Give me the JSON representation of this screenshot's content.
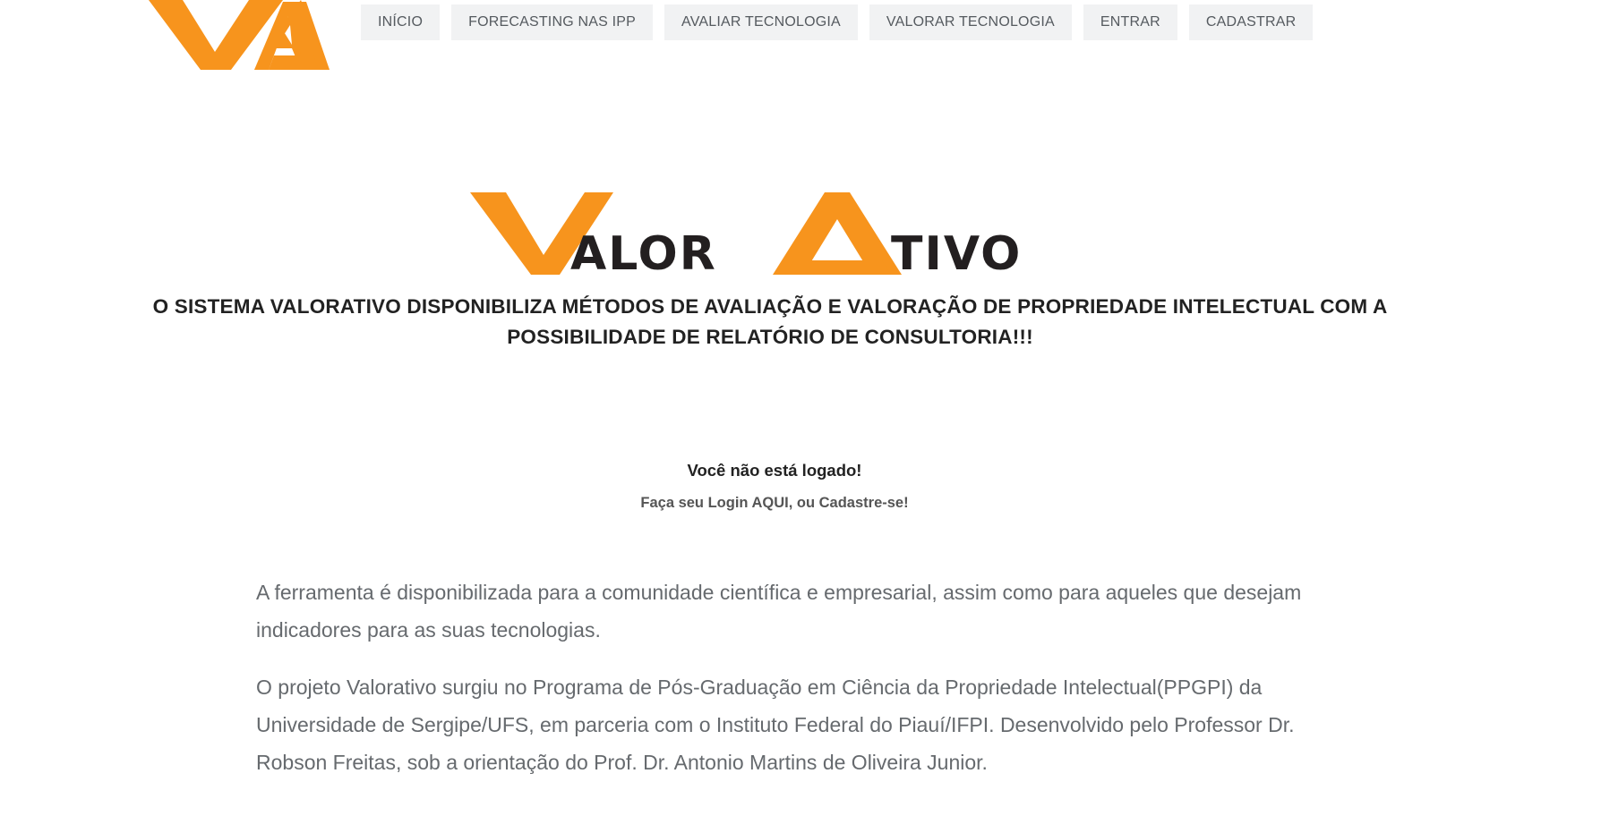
{
  "brand": {
    "logo_alt": "VA",
    "accent_color": "#f7941d",
    "dark_color": "#231f20"
  },
  "nav": {
    "items": [
      {
        "label": "INÍCIO"
      },
      {
        "label": "FORECASTING NAS IPP"
      },
      {
        "label": "AVALIAR TECNOLOGIA"
      },
      {
        "label": "VALORAR TECNOLOGIA"
      },
      {
        "label": "ENTRAR"
      },
      {
        "label": "CADASTRAR"
      }
    ]
  },
  "hero": {
    "logo_letter_v": "V",
    "logo_text_1": "ALOR",
    "logo_letter_a": "A",
    "logo_text_2": "TIVO",
    "tagline_line1": "O SISTEMA VALORATIVO DISPONIBILIZA MÉTODOS DE AVALIAÇÃO E VALORAÇÃO DE PROPRIEDADE INTELECTUAL COM A",
    "tagline_line2": "POSSIBILIDADE DE RELATÓRIO DE CONSULTORIA!!!"
  },
  "login_notice": {
    "title": "Você não está logado!",
    "subtitle": "Faça seu Login AQUI, ou Cadastre-se!"
  },
  "content": {
    "paragraph1": "A ferramenta é disponibilizada para a comunidade científica e empresarial, assim como para aqueles que desejam indicadores para as suas tecnologias.",
    "paragraph2": "O projeto Valorativo surgiu no Programa de Pós-Graduação em Ciência da Propriedade Intelectual(PPGPI) da Universidade de Sergipe/UFS, em parceria com o Instituto Federal do Piauí/IFPI. Desenvolvido pelo Professor Dr. Robson Freitas, sob a orientação do Prof. Dr. Antonio Martins de Oliveira Junior."
  }
}
